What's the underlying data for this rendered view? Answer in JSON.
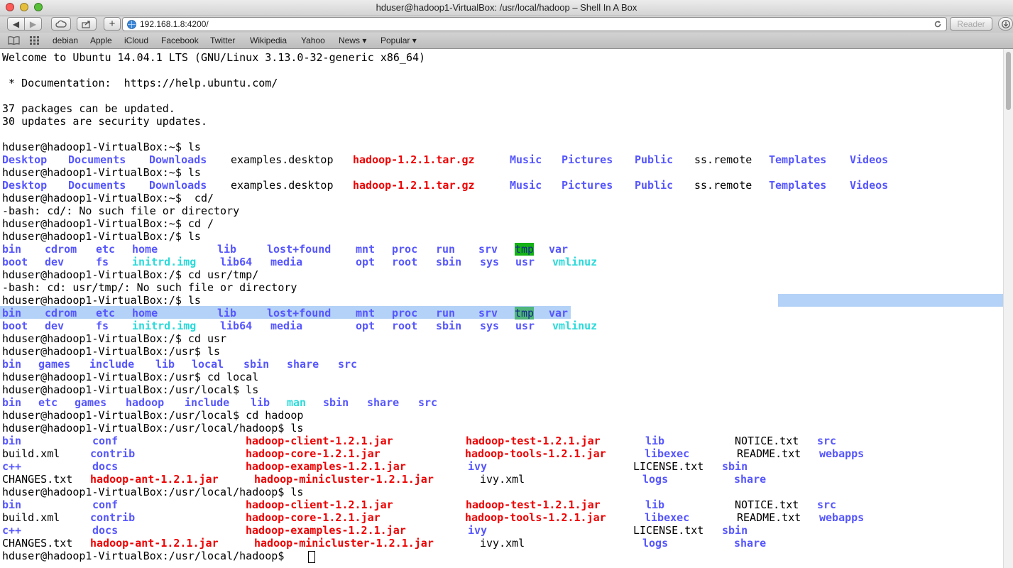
{
  "window": {
    "title": "hduser@hadoop1-VirtualBox: /usr/local/hadoop – Shell In A Box",
    "traffic_colors": [
      "#fc5b57",
      "#e5bf3c",
      "#57c038"
    ]
  },
  "toolbar": {
    "back_icon": "back-arrow-icon",
    "forward_icon": "forward-arrow-icon",
    "cloud_icon": "cloud-icon",
    "share_icon": "share-icon",
    "add_icon": "plus-icon",
    "url": "192.168.1.8:4200/",
    "reload_icon": "reload-icon",
    "reader_label": "Reader",
    "download_icon": "download-icon"
  },
  "bookmarks": {
    "items": [
      "debian",
      "Apple",
      "iCloud",
      "Facebook",
      "Twitter",
      "Wikipedia",
      "Yahoo",
      "News ▾",
      "Popular ▾"
    ]
  },
  "terminal": {
    "lines": [
      "Welcome to Ubuntu 14.04.1 LTS (GNU/Linux 3.13.0-32-generic x86_64)",
      "",
      " * Documentation:  https://help.ubuntu.com/",
      "",
      "37 packages can be updated.",
      "30 updates are security updates.",
      "",
      "hduser@hadoop1-VirtualBox:~$ ls",
      "",
      "hduser@hadoop1-VirtualBox:~$ ls",
      "",
      "hduser@hadoop1-VirtualBox:~$  cd/",
      "-bash: cd/: No such file or directory",
      "hduser@hadoop1-VirtualBox:~$ cd /",
      "hduser@hadoop1-VirtualBox:/$ ls",
      "",
      "",
      "hduser@hadoop1-VirtualBox:/$ cd usr/tmp/",
      "-bash: cd: usr/tmp/: No such file or directory",
      "hduser@hadoop1-VirtualBox:/$ ls",
      "",
      "",
      "hduser@hadoop1-VirtualBox:/$ cd usr",
      "hduser@hadoop1-VirtualBox:/usr$ ls",
      "",
      "hduser@hadoop1-VirtualBox:/usr$ cd local",
      "hduser@hadoop1-VirtualBox:/usr/local$ ls",
      "",
      "hduser@hadoop1-VirtualBox:/usr/local$ cd hadoop",
      "hduser@hadoop1-VirtualBox:/usr/local/hadoop$ ls",
      "",
      "",
      "",
      "",
      "hduser@hadoop1-VirtualBox:/usr/local/hadoop$ ls",
      "",
      "",
      "",
      "",
      "hduser@hadoop1-VirtualBox:/usr/local/hadoop$ "
    ],
    "home_ls": [
      "Desktop",
      "Documents",
      "Downloads",
      "examples.desktop",
      "hadoop-1.2.1.tar.gz",
      "Music",
      "Pictures",
      "Public",
      "ss.remote",
      "Templates",
      "Videos"
    ],
    "root_ls": {
      "row1": [
        "bin",
        "cdrom",
        "etc",
        "home",
        "lib",
        "lost+found",
        "mnt",
        "proc",
        "run",
        "srv",
        "tmp",
        "var"
      ],
      "row2": [
        "boot",
        "dev",
        "fs",
        "initrd.img",
        "lib64",
        "media",
        "opt",
        "root",
        "sbin",
        "sys",
        "usr",
        "vmlinuz"
      ]
    },
    "usr_ls": [
      "bin",
      "games",
      "include",
      "lib",
      "local",
      "sbin",
      "share",
      "src"
    ],
    "local_ls": [
      "bin",
      "etc",
      "games",
      "hadoop",
      "include",
      "lib",
      "man",
      "sbin",
      "share",
      "src"
    ],
    "hadoop_ls": {
      "row1": [
        "bin",
        "conf",
        "hadoop-client-1.2.1.jar",
        "hadoop-test-1.2.1.jar",
        "lib",
        "NOTICE.txt",
        "src"
      ],
      "row2": [
        "build.xml",
        "contrib",
        "hadoop-core-1.2.1.jar",
        "hadoop-tools-1.2.1.jar",
        "libexec",
        "README.txt",
        "webapps"
      ],
      "row3": [
        "c++",
        "docs",
        "hadoop-examples-1.2.1.jar",
        "ivy",
        "LICENSE.txt",
        "sbin"
      ],
      "row4": [
        "CHANGES.txt",
        "hadoop-ant-1.2.1.jar",
        "hadoop-minicluster-1.2.1.jar",
        "ivy.xml",
        "logs",
        "share"
      ]
    }
  },
  "colors": {
    "directory": "#5656ff",
    "archive": "#ee0000",
    "symlink": "#2adada",
    "tmp_highlight": "#16b216",
    "selection": "#b4d2f7"
  }
}
